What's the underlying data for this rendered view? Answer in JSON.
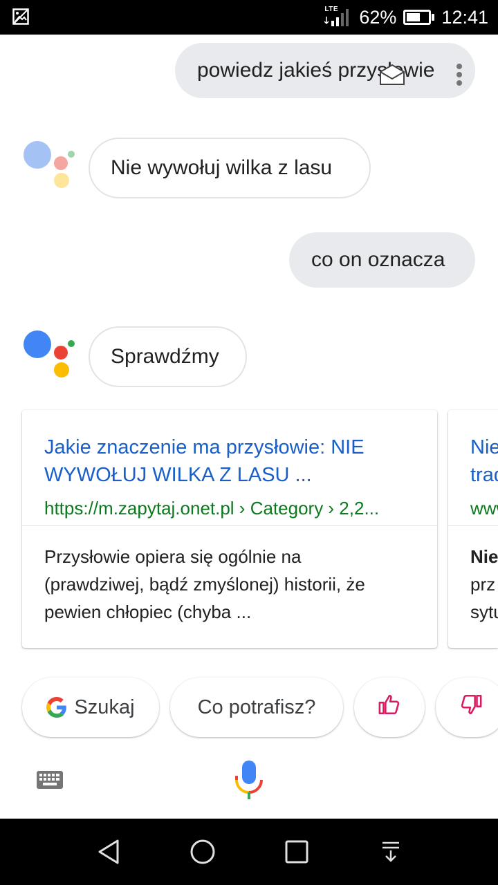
{
  "status_bar": {
    "network_label": "LTE",
    "battery_percent": "62%",
    "battery_level": 0.62,
    "time": "12:41"
  },
  "conversation": {
    "user_query_1": "powiedz jakieś przysłowie",
    "assistant_reply_1": "Nie wywołuj wilka z lasu",
    "user_query_2": "co on oznacza",
    "assistant_reply_2": "Sprawdźmy"
  },
  "results": [
    {
      "title_line_1": "Jakie znaczenie ma przysłowie: NIE",
      "title_line_2": "WYWOŁUJ WILKA Z LASU ...",
      "url": "https://m.zapytaj.onet.pl › Category › 2,2...",
      "snippet_line_1": "Przysłowie opiera się ogólnie na",
      "snippet_line_2": "(prawdziwej, bądź zmyślonej) historii, że",
      "snippet_line_3": "pewien chłopiec (chyba ..."
    },
    {
      "title_line_1": "Nie",
      "title_line_2": "trad",
      "url": "www",
      "snippet_line_1": "Nie",
      "snippet_line_2": "prz",
      "snippet_line_3": "sytu"
    }
  ],
  "suggestions": {
    "search_label": "Szukaj",
    "capabilities_label": "Co potrafisz?"
  },
  "colors": {
    "google_blue": "#4285f4",
    "google_red": "#ea4335",
    "google_yellow": "#fbbc04",
    "google_green": "#34a853",
    "link_title": "#1a5fc8",
    "link_url": "#0b7a1d",
    "feedback_pink": "#d81b60"
  },
  "icons": {
    "status_left": "image-icon",
    "keyboard": "keyboard-icon",
    "mic": "mic-icon",
    "nav_back": "back-triangle-icon",
    "nav_home": "home-circle-icon",
    "nav_recents": "recents-square-icon",
    "nav_notifications": "pull-down-icon"
  }
}
